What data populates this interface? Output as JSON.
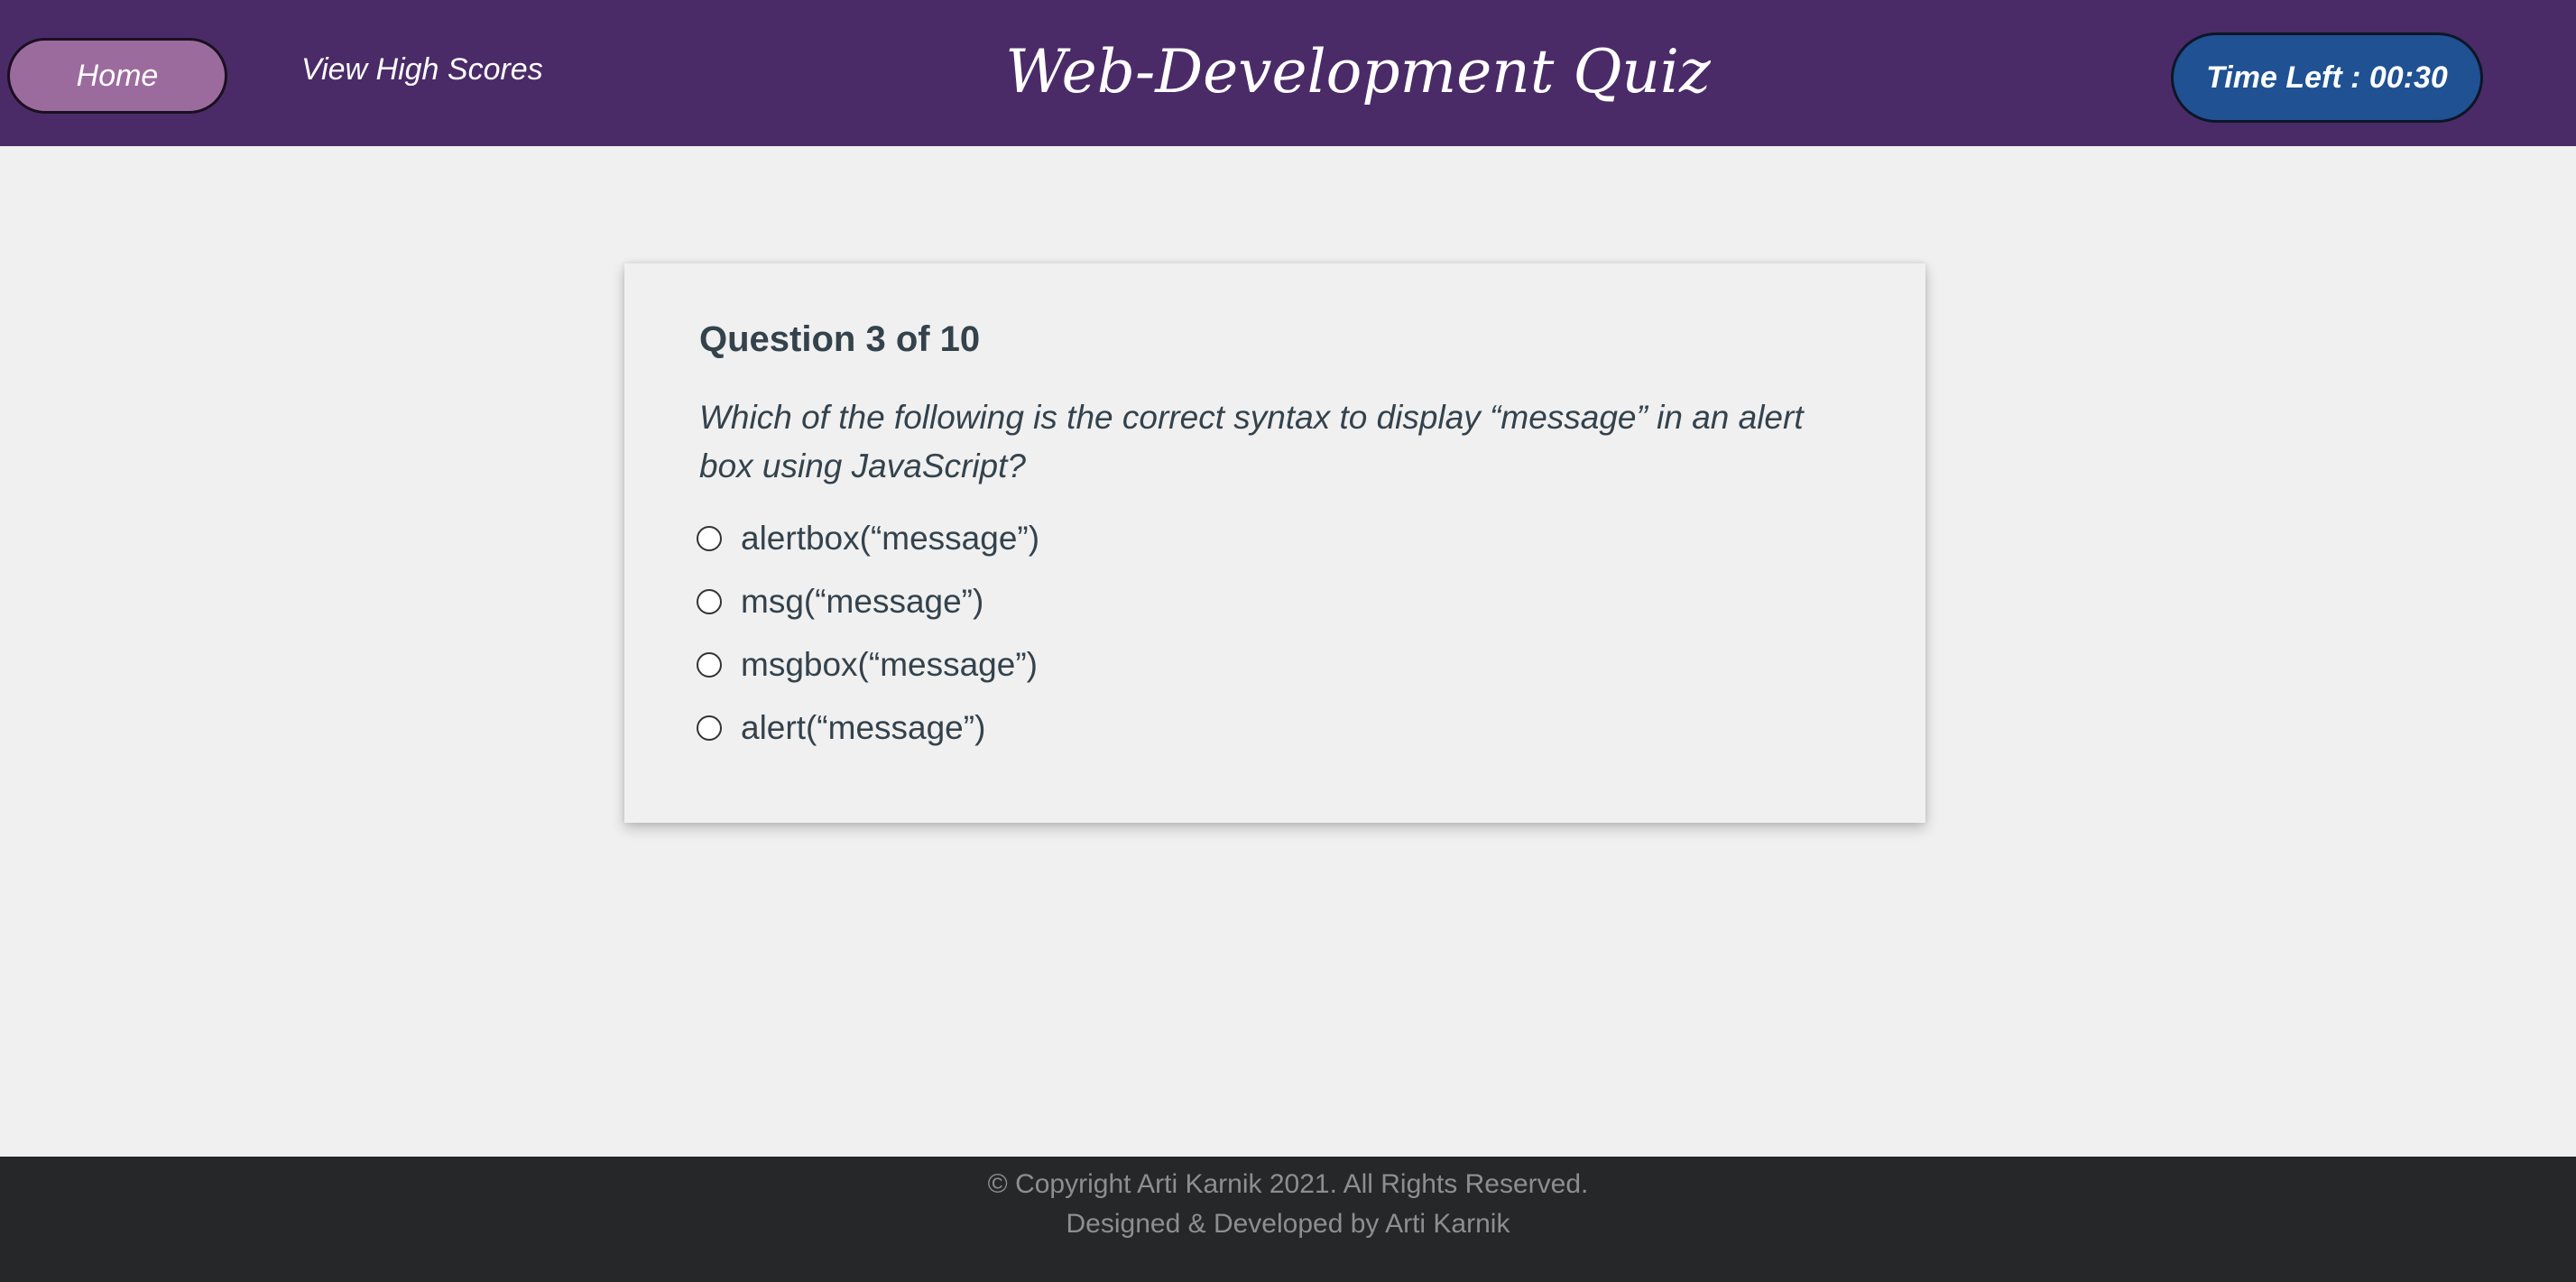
{
  "header": {
    "home_label": "Home",
    "high_scores_label": "View High Scores",
    "title": "Web-Development Quiz",
    "timer_label": "Time Left : 00:30",
    "colors": {
      "header_bg": "#4a2b68",
      "home_bg": "#9c6b9e",
      "timer_bg": "#1f5193"
    }
  },
  "quiz": {
    "counter": "Question 3 of 10",
    "question": "Which of the following is the correct syntax to display “message” in an alert box using JavaScript?",
    "options": [
      {
        "label": "alertbox(“message”)",
        "selected": false
      },
      {
        "label": "msg(“message”)",
        "selected": false
      },
      {
        "label": "msgbox(“message”)",
        "selected": false
      },
      {
        "label": "alert(“message”)",
        "selected": false
      }
    ]
  },
  "footer": {
    "copyright": "© Copyright Arti Karnik 2021. All Rights Reserved.",
    "credit": "Designed & Developed by Arti Karnik"
  }
}
